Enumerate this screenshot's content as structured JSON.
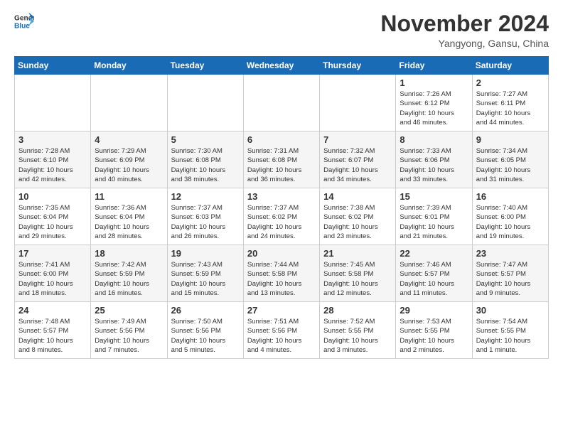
{
  "logo": {
    "line1": "General",
    "line2": "Blue"
  },
  "title": "November 2024",
  "subtitle": "Yangyong, Gansu, China",
  "weekdays": [
    "Sunday",
    "Monday",
    "Tuesday",
    "Wednesday",
    "Thursday",
    "Friday",
    "Saturday"
  ],
  "weeks": [
    [
      {
        "day": "",
        "info": ""
      },
      {
        "day": "",
        "info": ""
      },
      {
        "day": "",
        "info": ""
      },
      {
        "day": "",
        "info": ""
      },
      {
        "day": "",
        "info": ""
      },
      {
        "day": "1",
        "info": "Sunrise: 7:26 AM\nSunset: 6:12 PM\nDaylight: 10 hours\nand 46 minutes."
      },
      {
        "day": "2",
        "info": "Sunrise: 7:27 AM\nSunset: 6:11 PM\nDaylight: 10 hours\nand 44 minutes."
      }
    ],
    [
      {
        "day": "3",
        "info": "Sunrise: 7:28 AM\nSunset: 6:10 PM\nDaylight: 10 hours\nand 42 minutes."
      },
      {
        "day": "4",
        "info": "Sunrise: 7:29 AM\nSunset: 6:09 PM\nDaylight: 10 hours\nand 40 minutes."
      },
      {
        "day": "5",
        "info": "Sunrise: 7:30 AM\nSunset: 6:08 PM\nDaylight: 10 hours\nand 38 minutes."
      },
      {
        "day": "6",
        "info": "Sunrise: 7:31 AM\nSunset: 6:08 PM\nDaylight: 10 hours\nand 36 minutes."
      },
      {
        "day": "7",
        "info": "Sunrise: 7:32 AM\nSunset: 6:07 PM\nDaylight: 10 hours\nand 34 minutes."
      },
      {
        "day": "8",
        "info": "Sunrise: 7:33 AM\nSunset: 6:06 PM\nDaylight: 10 hours\nand 33 minutes."
      },
      {
        "day": "9",
        "info": "Sunrise: 7:34 AM\nSunset: 6:05 PM\nDaylight: 10 hours\nand 31 minutes."
      }
    ],
    [
      {
        "day": "10",
        "info": "Sunrise: 7:35 AM\nSunset: 6:04 PM\nDaylight: 10 hours\nand 29 minutes."
      },
      {
        "day": "11",
        "info": "Sunrise: 7:36 AM\nSunset: 6:04 PM\nDaylight: 10 hours\nand 28 minutes."
      },
      {
        "day": "12",
        "info": "Sunrise: 7:37 AM\nSunset: 6:03 PM\nDaylight: 10 hours\nand 26 minutes."
      },
      {
        "day": "13",
        "info": "Sunrise: 7:37 AM\nSunset: 6:02 PM\nDaylight: 10 hours\nand 24 minutes."
      },
      {
        "day": "14",
        "info": "Sunrise: 7:38 AM\nSunset: 6:02 PM\nDaylight: 10 hours\nand 23 minutes."
      },
      {
        "day": "15",
        "info": "Sunrise: 7:39 AM\nSunset: 6:01 PM\nDaylight: 10 hours\nand 21 minutes."
      },
      {
        "day": "16",
        "info": "Sunrise: 7:40 AM\nSunset: 6:00 PM\nDaylight: 10 hours\nand 19 minutes."
      }
    ],
    [
      {
        "day": "17",
        "info": "Sunrise: 7:41 AM\nSunset: 6:00 PM\nDaylight: 10 hours\nand 18 minutes."
      },
      {
        "day": "18",
        "info": "Sunrise: 7:42 AM\nSunset: 5:59 PM\nDaylight: 10 hours\nand 16 minutes."
      },
      {
        "day": "19",
        "info": "Sunrise: 7:43 AM\nSunset: 5:59 PM\nDaylight: 10 hours\nand 15 minutes."
      },
      {
        "day": "20",
        "info": "Sunrise: 7:44 AM\nSunset: 5:58 PM\nDaylight: 10 hours\nand 13 minutes."
      },
      {
        "day": "21",
        "info": "Sunrise: 7:45 AM\nSunset: 5:58 PM\nDaylight: 10 hours\nand 12 minutes."
      },
      {
        "day": "22",
        "info": "Sunrise: 7:46 AM\nSunset: 5:57 PM\nDaylight: 10 hours\nand 11 minutes."
      },
      {
        "day": "23",
        "info": "Sunrise: 7:47 AM\nSunset: 5:57 PM\nDaylight: 10 hours\nand 9 minutes."
      }
    ],
    [
      {
        "day": "24",
        "info": "Sunrise: 7:48 AM\nSunset: 5:57 PM\nDaylight: 10 hours\nand 8 minutes."
      },
      {
        "day": "25",
        "info": "Sunrise: 7:49 AM\nSunset: 5:56 PM\nDaylight: 10 hours\nand 7 minutes."
      },
      {
        "day": "26",
        "info": "Sunrise: 7:50 AM\nSunset: 5:56 PM\nDaylight: 10 hours\nand 5 minutes."
      },
      {
        "day": "27",
        "info": "Sunrise: 7:51 AM\nSunset: 5:56 PM\nDaylight: 10 hours\nand 4 minutes."
      },
      {
        "day": "28",
        "info": "Sunrise: 7:52 AM\nSunset: 5:55 PM\nDaylight: 10 hours\nand 3 minutes."
      },
      {
        "day": "29",
        "info": "Sunrise: 7:53 AM\nSunset: 5:55 PM\nDaylight: 10 hours\nand 2 minutes."
      },
      {
        "day": "30",
        "info": "Sunrise: 7:54 AM\nSunset: 5:55 PM\nDaylight: 10 hours\nand 1 minute."
      }
    ]
  ]
}
